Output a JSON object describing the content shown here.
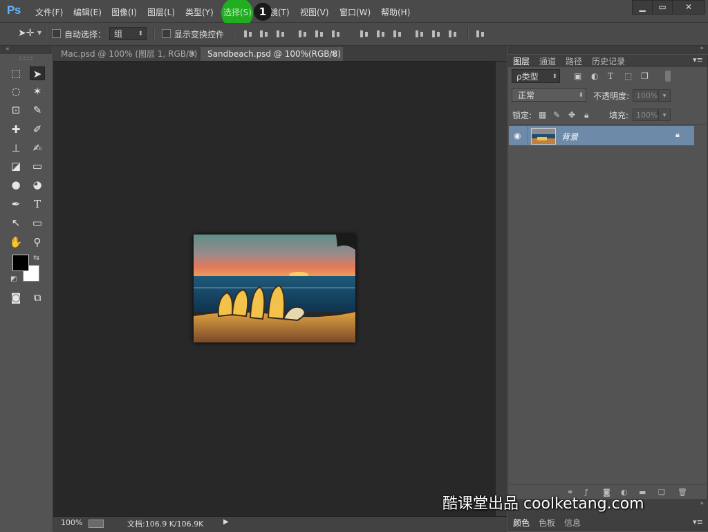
{
  "app": {
    "logo": "Ps"
  },
  "menu": {
    "items": [
      "文件(F)",
      "编辑(E)",
      "图像(I)",
      "图层(L)",
      "类型(Y)",
      "选择(S)",
      "滤镜(T)",
      "视图(V)",
      "窗口(W)",
      "帮助(H)"
    ],
    "step_badge": "1"
  },
  "window_controls": {
    "minimize": "▁",
    "restore": "▭",
    "close": "✕"
  },
  "options_bar": {
    "auto_select_label": "自动选择：",
    "auto_select_value": "组",
    "show_transform_label": "显示变换控件"
  },
  "toolbar": {
    "tools": [
      "marquee-icon",
      "move-icon",
      "lasso-icon",
      "magic-wand-icon",
      "crop-icon",
      "eyedropper-icon",
      "healing-brush-icon",
      "brush-icon",
      "clone-stamp-icon",
      "history-brush-icon",
      "eraser-icon",
      "gradient-icon",
      "blur-icon",
      "dodge-icon",
      "pen-icon",
      "type-icon",
      "path-selection-icon",
      "rectangle-icon",
      "hand-icon",
      "zoom-icon"
    ],
    "type_tool_glyph": "T"
  },
  "documents": {
    "tabs": [
      {
        "label": "Mac.psd @ 100% (图层 1, RGB/8)",
        "active": false
      },
      {
        "label": "Sandbeach.psd @ 100%(RGB/8)",
        "active": true
      }
    ],
    "close_glyph": "×"
  },
  "status": {
    "zoom": "100%",
    "doc_size": "文档:106.9 K/106.9K"
  },
  "layers_panel": {
    "tabs": [
      "图层",
      "通道",
      "路径",
      "历史记录"
    ],
    "kind_filter": "ρ类型",
    "blend_mode": "正常",
    "opacity_label": "不透明度:",
    "opacity_value": "100%",
    "lock_label": "锁定:",
    "fill_label": "填充:",
    "fill_value": "100%",
    "layers": [
      {
        "name": "背景",
        "visible": true,
        "locked": true
      }
    ]
  },
  "bottom_panel": {
    "tabs": [
      "颜色",
      "色板",
      "信息"
    ]
  },
  "watermark": "酷课堂出品 coolketang.com"
}
